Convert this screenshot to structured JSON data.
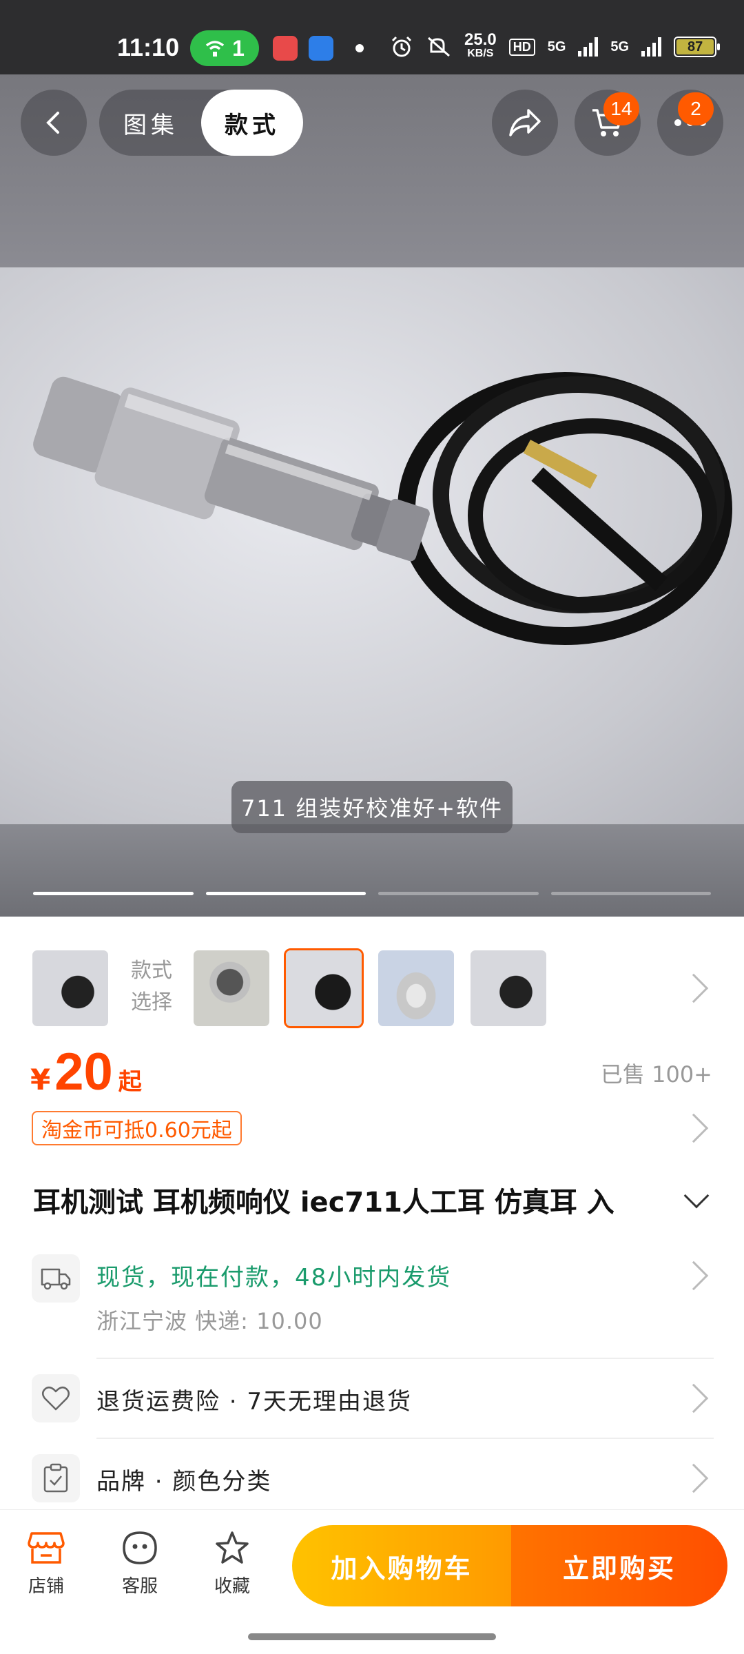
{
  "status_bar": {
    "time": "11:10",
    "hotspot_count": "1",
    "net_speed_value": "25.0",
    "net_speed_unit": "KB/S",
    "hd_label": "HD",
    "signal1_label": "5G",
    "signal2_label": "5G",
    "battery": "87"
  },
  "header": {
    "tab_gallery": "图集",
    "tab_style": "款式",
    "cart_badge": "14",
    "more_badge": "2"
  },
  "hero": {
    "caption": "711 组装好校准好+软件",
    "total_slides": 4,
    "active_slides": 2
  },
  "variants": {
    "label": "款式选择"
  },
  "price": {
    "currency": "¥",
    "value": "20",
    "suffix": "起",
    "sold": "已售 100+",
    "coin_tag": "淘金币可抵0.60元起"
  },
  "product": {
    "title": "耳机测试 耳机频响仪 iec711人工耳 仿真耳 入"
  },
  "shipping": {
    "main": "现货，现在付款，48小时内发货",
    "sub": "浙江宁波  快递: 10.00"
  },
  "services": {
    "text": "退货运费险 · 7天无理由退货"
  },
  "params": {
    "text": "品牌 · 颜色分类"
  },
  "bottom_bar": {
    "shop": "店铺",
    "service": "客服",
    "favorite": "收藏",
    "add_to_cart": "加入购物车",
    "buy_now": "立即购买"
  },
  "colors": {
    "accent": "#ff5a00",
    "price": "#ff4400",
    "shipping_green": "#1a9b6c"
  }
}
